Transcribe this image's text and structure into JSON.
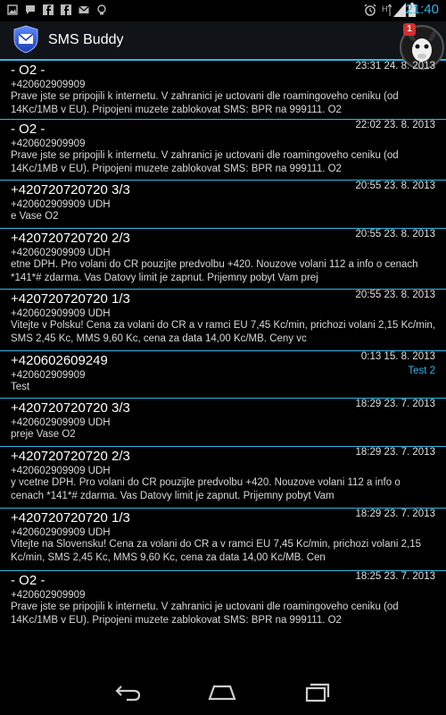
{
  "status_bar": {
    "time": "21:40"
  },
  "app": {
    "title": "SMS Buddy",
    "badge_count": "1"
  },
  "messages": [
    {
      "sender": "- O2 -",
      "date": "23:31 24. 8. 2013",
      "number": "+420602909909",
      "body": "Prave jste se pripojili k internetu. V zahranici je uctovani dle roamingoveho ceniku (od 14Kc/1MB v EU). Pripojeni muzete zablokovat SMS: BPR na 999111. O2",
      "tag": ""
    },
    {
      "sender": "- O2 -",
      "date": "22:02 23. 8. 2013",
      "number": "+420602909909",
      "body": "Prave jste se pripojili k internetu. V zahranici je uctovani dle roamingoveho ceniku (od 14Kc/1MB v EU). Pripojeni muzete zablokovat SMS: BPR na 999111. O2",
      "tag": ""
    },
    {
      "sender": "+420720720720 3/3",
      "date": "20:55 23. 8. 2013",
      "number": "+420602909909 UDH",
      "body": "e Vase O2",
      "tag": ""
    },
    {
      "sender": "+420720720720 2/3",
      "date": "20:55 23. 8. 2013",
      "number": "+420602909909 UDH",
      "body": "etne DPH. Pro volani do CR pouzijte predvolbu +420. Nouzove volani 112 a info o cenach *141*# zdarma. Vas Datovy limit je zapnut. Prijemny pobyt Vam prej",
      "tag": ""
    },
    {
      "sender": "+420720720720 1/3",
      "date": "20:55 23. 8. 2013",
      "number": "+420602909909 UDH",
      "body": "Vitejte v Polsku! Cena za volani do CR a v ramci EU 7,45 Kc/min, prichozi volani 2,15 Kc/min, SMS 2,45 Kc, MMS 9,60 Kc, cena za data 14,00 Kc/MB. Ceny vc",
      "tag": ""
    },
    {
      "sender": "+420602609249",
      "date": "0:13 15. 8. 2013",
      "number": "+420602909909",
      "body": "Test",
      "tag": "Test 2"
    },
    {
      "sender": "+420720720720 3/3",
      "date": "18:29 23. 7. 2013",
      "number": "+420602909909 UDH",
      "body": " preje Vase O2",
      "tag": ""
    },
    {
      "sender": "+420720720720 2/3",
      "date": "18:29 23. 7. 2013",
      "number": "+420602909909 UDH",
      "body": "y vcetne DPH. Pro volani do CR pouzijte predvolbu +420.  Nouzove volani 112 a info o cenach *141*# zdarma. Vas Datovy limit je zapnut. Prijemny pobyt Vam",
      "tag": ""
    },
    {
      "sender": "+420720720720 1/3",
      "date": "18:29 23. 7. 2013",
      "number": "+420602909909 UDH",
      "body": "Vitejte na Slovensku! Cena za volani do CR a v ramci EU 7,45 Kc/min, prichozi volani 2,15 Kc/min, SMS 2,45 Kc, MMS 9,60 Kc, cena za data 14,00 Kc/MB. Cen",
      "tag": ""
    },
    {
      "sender": "- O2 -",
      "date": "18:25 23. 7. 2013",
      "number": "+420602909909",
      "body": "Prave jste se pripojili k internetu. V zahranici je uctovani dle roamingoveho ceniku (od 14Kc/1MB v EU). Pripojeni muzete zablokovat SMS: BPR na 999111. O2",
      "tag": ""
    }
  ]
}
